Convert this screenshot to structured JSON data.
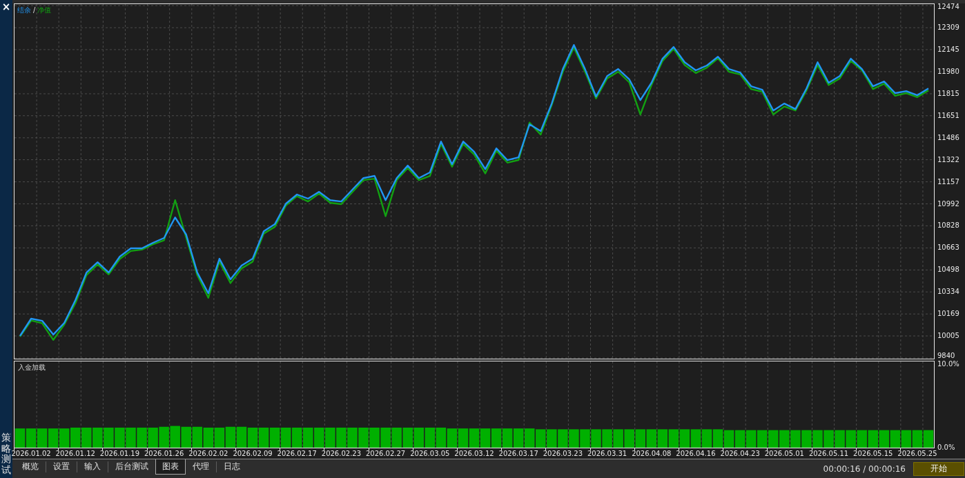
{
  "sidebar": {
    "close": "×",
    "title": "策略测试"
  },
  "charts": [
    {
      "legend_separator": "/",
      "chart_data": {
        "type": "line",
        "grid": true,
        "categories": [
          null,
          null,
          null,
          null,
          null,
          null,
          null,
          null,
          null,
          null,
          null,
          null,
          null,
          null,
          null,
          null,
          null,
          null,
          null,
          null,
          null,
          null,
          null,
          null,
          null,
          null,
          null,
          null,
          null,
          null,
          null,
          null,
          null,
          null,
          null,
          null,
          null,
          null,
          null,
          null,
          null,
          null,
          null,
          null,
          null,
          null,
          null,
          null,
          null,
          null,
          null,
          null,
          null,
          null,
          null,
          null,
          null,
          null,
          null,
          null,
          null,
          null,
          null,
          null,
          null,
          null,
          null,
          null,
          null,
          null,
          null,
          null,
          null,
          null,
          null,
          null,
          null,
          null,
          null,
          null,
          null,
          null,
          null
        ],
        "series": [
          {
            "name": "结余",
            "color": "#2196f3",
            "values": [
              10005,
              10134,
              10118,
              10015,
              10103,
              10273,
              10479,
              10556,
              10479,
              10598,
              10660,
              10660,
              10701,
              10737,
              10891,
              10763,
              10479,
              10324,
              10582,
              10428,
              10531,
              10582,
              10788,
              10840,
              10994,
              11062,
              11031,
              11082,
              11020,
              11010,
              11098,
              11185,
              11201,
              11020,
              11185,
              11278,
              11185,
              11227,
              11458,
              11288,
              11458,
              11381,
              11252,
              11407,
              11319,
              11340,
              11587,
              11536,
              11742,
              12000,
              12180,
              12000,
              11794,
              11948,
              12000,
              11922,
              11768,
              11897,
              12077,
              12165,
              12051,
              11990,
              12026,
              12092,
              12000,
              11974,
              11871,
              11845,
              11690,
              11742,
              11701,
              11855,
              12051,
              11897,
              11948,
              12077,
              12000,
              11871,
              11907,
              11820,
              11835,
              11804,
              11855
            ]
          },
          {
            "name": "净值",
            "color": "#12a012",
            "values": [
              10000,
              10120,
              10100,
              9975,
              10090,
              10250,
              10460,
              10540,
              10465,
              10580,
              10640,
              10650,
              10690,
              10720,
              11020,
              10740,
              10460,
              10290,
              10560,
              10400,
              10510,
              10560,
              10770,
              10820,
              10980,
              11050,
              11010,
              11070,
              11000,
              10990,
              11080,
              11170,
              11180,
              10900,
              11170,
              11260,
              11170,
              11200,
              11440,
              11270,
              11440,
              11360,
              11220,
              11390,
              11300,
              11320,
              11600,
              11510,
              11730,
              11980,
              12160,
              11980,
              11780,
              11930,
              11980,
              11900,
              11660,
              11880,
              12060,
              12150,
              12030,
              11970,
              12010,
              12080,
              11980,
              11960,
              11850,
              11830,
              11660,
              11720,
              11690,
              11840,
              12030,
              11880,
              11930,
              12060,
              11990,
              11850,
              11890,
              11800,
              11820,
              11790,
              11840
            ]
          }
        ],
        "ylim": [
          9835,
          12485
        ],
        "yticks": [
          12474,
          12309,
          12145,
          11980,
          11815,
          11651,
          11486,
          11322,
          11157,
          10992,
          10828,
          10663,
          10498,
          10334,
          10169,
          10005,
          9840
        ]
      }
    },
    {
      "chart_data": {
        "type": "bar",
        "title": "入金加载",
        "grid": true,
        "categories": [
          null,
          "2026.01.02",
          null,
          null,
          null,
          "2026.01.12",
          null,
          null,
          null,
          "2026.01.19",
          null,
          null,
          null,
          "2026.01.26",
          null,
          null,
          null,
          "2026.02.02",
          null,
          null,
          null,
          "2026.02.09",
          null,
          null,
          null,
          "2026.02.17",
          null,
          null,
          null,
          "2026.02.23",
          null,
          null,
          null,
          "2026.02.27",
          null,
          null,
          null,
          "2026.03.05",
          null,
          null,
          null,
          "2026.03.12",
          null,
          null,
          null,
          "2026.03.17",
          null,
          null,
          null,
          "2026.03.23",
          null,
          null,
          null,
          "2026.03.31",
          null,
          null,
          null,
          "2026.04.08",
          null,
          null,
          null,
          "2026.04.16",
          null,
          null,
          null,
          "2026.04.23",
          null,
          null,
          null,
          "2026.05.01",
          null,
          null,
          null,
          "2026.05.11",
          null,
          null,
          null,
          "2026.05.15",
          null,
          null,
          null,
          "2026.05.25",
          null
        ],
        "series": [
          {
            "color": "#00b000",
            "values": [
              2.3,
              2.3,
              2.3,
              2.3,
              2.3,
              2.4,
              2.4,
              2.4,
              2.4,
              2.4,
              2.4,
              2.4,
              2.4,
              2.5,
              2.6,
              2.5,
              2.5,
              2.4,
              2.4,
              2.5,
              2.5,
              2.4,
              2.4,
              2.4,
              2.4,
              2.4,
              2.4,
              2.4,
              2.4,
              2.4,
              2.4,
              2.4,
              2.4,
              2.4,
              2.4,
              2.4,
              2.4,
              2.4,
              2.4,
              2.3,
              2.3,
              2.3,
              2.3,
              2.3,
              2.3,
              2.3,
              2.3,
              2.2,
              2.2,
              2.2,
              2.2,
              2.2,
              2.2,
              2.2,
              2.2,
              2.2,
              2.2,
              2.2,
              2.2,
              2.2,
              2.2,
              2.2,
              2.2,
              2.2,
              2.1,
              2.1,
              2.1,
              2.1,
              2.1,
              2.1,
              2.1,
              2.1,
              2.1,
              2.1,
              2.1,
              2.1,
              2.1,
              2.1,
              2.1,
              2.1,
              2.1,
              2.1,
              2.1
            ]
          }
        ],
        "ylim": [
          0,
          10.33
        ],
        "yticks": [
          {
            "value": 10,
            "label": "10.0%"
          },
          {
            "value": 0,
            "label": "0.0%"
          }
        ]
      }
    }
  ],
  "tabs": [
    {
      "label": "概览",
      "selected": false
    },
    {
      "label": "设置",
      "selected": false
    },
    {
      "label": "输入",
      "selected": false
    },
    {
      "label": "后台测试",
      "selected": false
    },
    {
      "label": "图表",
      "selected": true
    },
    {
      "label": "代理",
      "selected": false
    },
    {
      "label": "日志",
      "selected": false
    }
  ],
  "timer": "00:00:16 / 00:00:16",
  "start_button": "开始"
}
